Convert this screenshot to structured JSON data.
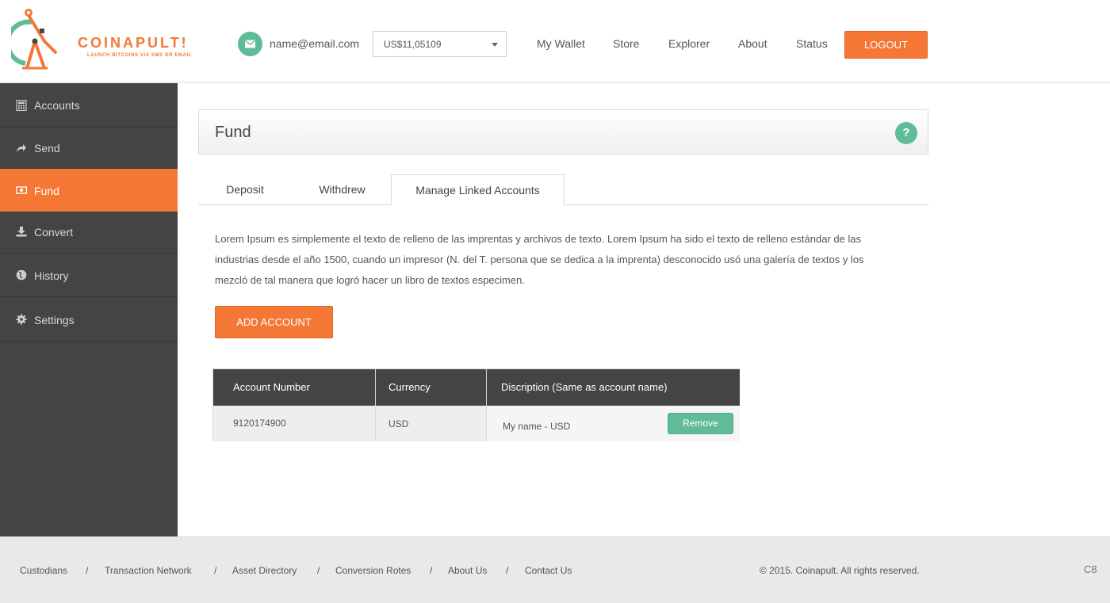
{
  "brand": {
    "name": "COINAPULT!",
    "tagline": "LAUNCH BITCOINS VIA SMS OR EMAIL",
    "accent_color": "#f47735",
    "secondary_color": "#5fbb98"
  },
  "header": {
    "email": "name@email.com",
    "balance": "US$11,05109",
    "nav": [
      "My Wallet",
      "Store",
      "Explorer",
      "About",
      "Status"
    ],
    "logout_label": "LOGOUT"
  },
  "sidebar": {
    "items": [
      {
        "label": "Accounts",
        "icon": "calculator-icon"
      },
      {
        "label": "Send",
        "icon": "share-icon"
      },
      {
        "label": "Fund",
        "icon": "money-icon",
        "active": true
      },
      {
        "label": "Convert",
        "icon": "download-icon"
      },
      {
        "label": "History",
        "icon": "globe-icon"
      },
      {
        "label": "Settings",
        "icon": "gear-icon"
      }
    ]
  },
  "main": {
    "title": "Fund",
    "help_label": "?",
    "tabs": [
      {
        "label": "Deposit"
      },
      {
        "label": "Withdrew"
      },
      {
        "label": "Manage Linked Accounts",
        "active": true
      }
    ],
    "description": "Lorem Ipsum es simplemente el texto de relleno de las imprentas y archivos de texto. Lorem Ipsum ha sido el texto de relleno estándar de las industrias desde el año 1500, cuando un impresor (N. del T. persona que se dedica a la imprenta) desconocido usó una galería de textos y los mezcló de tal manera que logró hacer un libro de textos especimen.",
    "add_account_label": "ADD ACCOUNT",
    "table": {
      "headers": [
        "Account Number",
        "Currency",
        "Discription (Same as account name)"
      ],
      "rows": [
        {
          "account_number": "9120174900",
          "currency": "USD",
          "description": "My name - USD",
          "action": "Remove"
        }
      ]
    }
  },
  "footer": {
    "links": [
      "Custodians",
      "Transaction Network",
      "Asset Directory",
      "Conversion Rotes",
      "About Us",
      "Contact Us"
    ],
    "separator": "/",
    "copyright": "© 2015. Coinapult. All rights reserved.",
    "corner": "C8"
  }
}
